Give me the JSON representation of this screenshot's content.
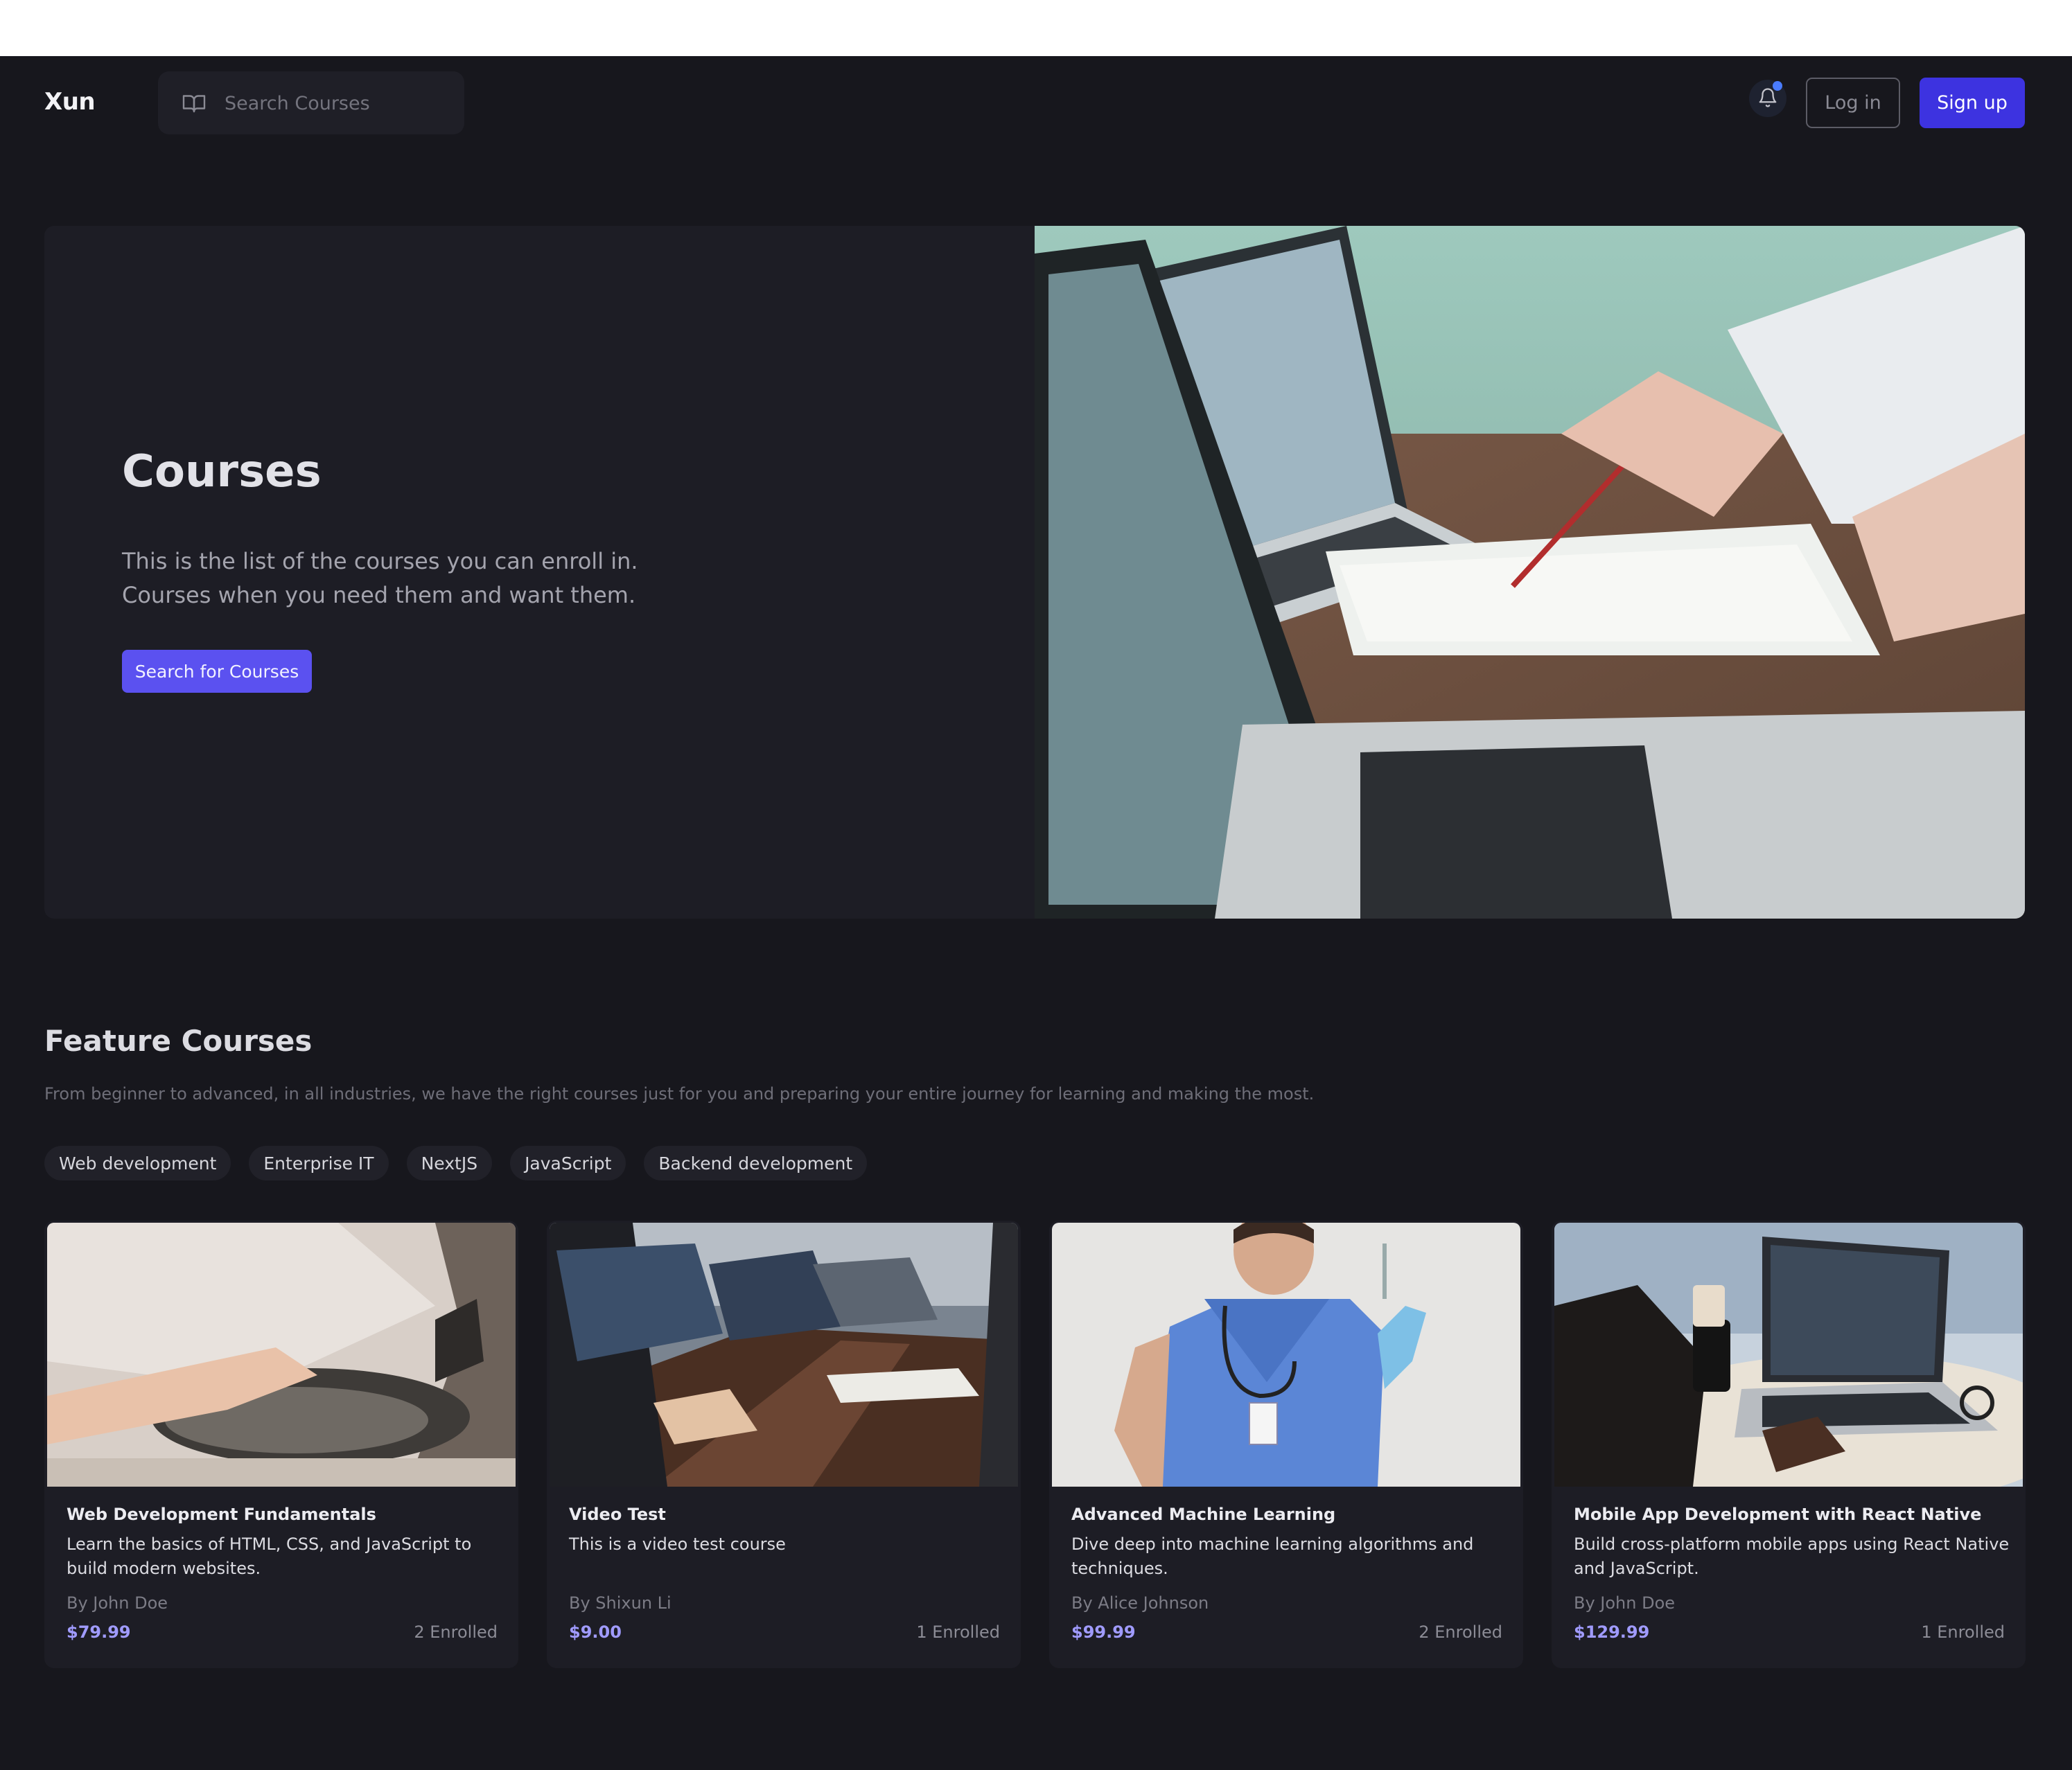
{
  "header": {
    "logo": "Xun",
    "search_placeholder": "Search Courses",
    "login_label": "Log in",
    "signup_label": "Sign up"
  },
  "hero": {
    "title": "Courses",
    "description_line1": "This is the list of the courses you can enroll in.",
    "description_line2": "Courses when you need them and want them.",
    "button_label": "Search for Courses"
  },
  "featured": {
    "title": "Feature Courses",
    "subtitle": "From beginner to advanced, in all industries, we have the right courses just for you and preparing your entire journey for learning and making the most.",
    "categories": [
      "Web development",
      "Enterprise IT",
      "NextJS",
      "JavaScript",
      "Backend development"
    ]
  },
  "courses": [
    {
      "title": "Web Development Fundamentals",
      "description": "Learn the basics of HTML, CSS, and JavaScript to build modern websites.",
      "author": "By John Doe",
      "price": "$79.99",
      "enrolled": "2 Enrolled"
    },
    {
      "title": "Video Test",
      "description": "This is a video test course",
      "author": "By Shixun Li",
      "price": "$9.00",
      "enrolled": "1 Enrolled"
    },
    {
      "title": "Advanced Machine Learning",
      "description": "Dive deep into machine learning algorithms and techniques.",
      "author": "By Alice Johnson",
      "price": "$99.99",
      "enrolled": "2 Enrolled"
    },
    {
      "title": "Mobile App Development with React Native",
      "description": "Build cross-platform mobile apps using React Native and JavaScript.",
      "author": "By John Doe",
      "price": "$129.99",
      "enrolled": "1 Enrolled"
    }
  ],
  "icons": {
    "search": "book-open-icon",
    "notifications": "bell-icon"
  },
  "colors": {
    "background": "#17171d",
    "accent": "#3d33e0",
    "hero_button": "#5b51f0",
    "price": "#a09bff",
    "notification_dot": "#4a7cff"
  }
}
